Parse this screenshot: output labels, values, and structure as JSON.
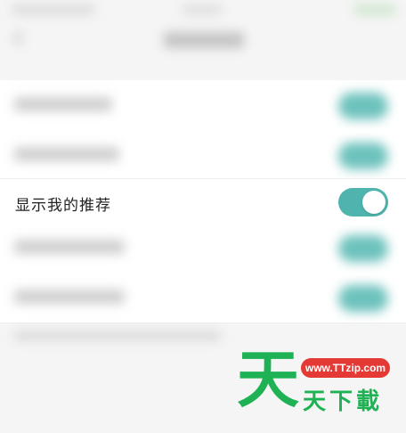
{
  "privacy_settings": {
    "show_recommendations": {
      "label": "显示我的推荐",
      "enabled": true
    }
  },
  "accent_color": "#4fb4ad",
  "watermark": {
    "big_char": "天",
    "url": "www.TTzip.com",
    "brand": "天下載",
    "brand_color": "#1fb254",
    "badge_color": "#e53935"
  }
}
